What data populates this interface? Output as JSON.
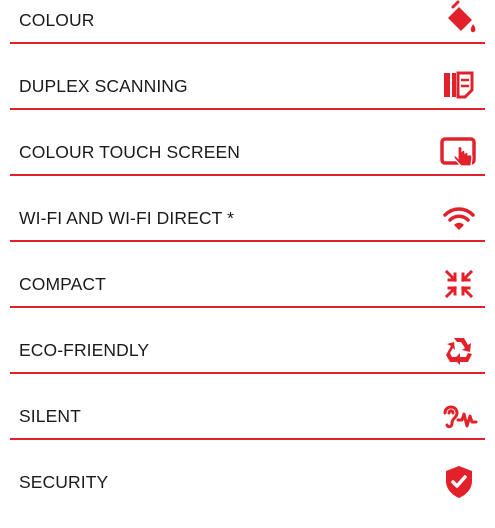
{
  "accent_color": "#e3212b",
  "features": [
    {
      "label": "COLOUR",
      "icon": "paint-bucket-icon"
    },
    {
      "label": "DUPLEX SCANNING",
      "icon": "duplex-pages-icon"
    },
    {
      "label": "COLOUR TOUCH SCREEN",
      "icon": "touch-screen-icon"
    },
    {
      "label": "WI-FI AND WI-FI DIRECT *",
      "icon": "wifi-icon"
    },
    {
      "label": "COMPACT",
      "icon": "compact-arrows-icon"
    },
    {
      "label": "ECO-FRIENDLY",
      "icon": "recycle-icon"
    },
    {
      "label": "SILENT",
      "icon": "ear-soundwave-icon"
    },
    {
      "label": "SECURITY",
      "icon": "shield-check-icon"
    }
  ]
}
